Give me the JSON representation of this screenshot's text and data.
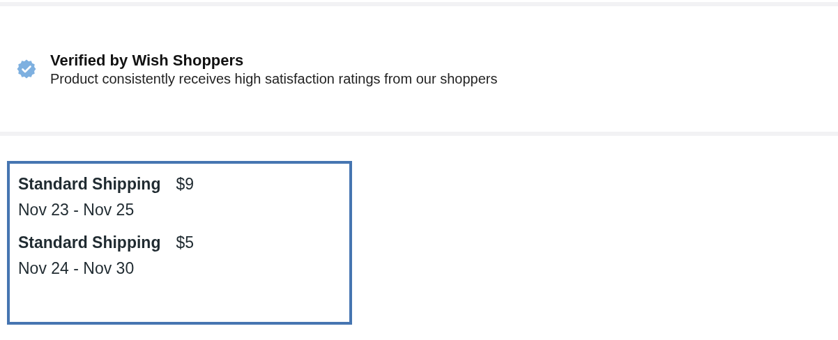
{
  "verified": {
    "title": "Verified by Wish Shoppers",
    "description": "Product consistently receives high satisfaction ratings from our shoppers"
  },
  "shipping_options": [
    {
      "name": "Standard Shipping",
      "price": "$9",
      "dates": "Nov 23 - Nov 25"
    },
    {
      "name": "Standard Shipping",
      "price": "$5",
      "dates": "Nov 24 - Nov 30"
    }
  ]
}
